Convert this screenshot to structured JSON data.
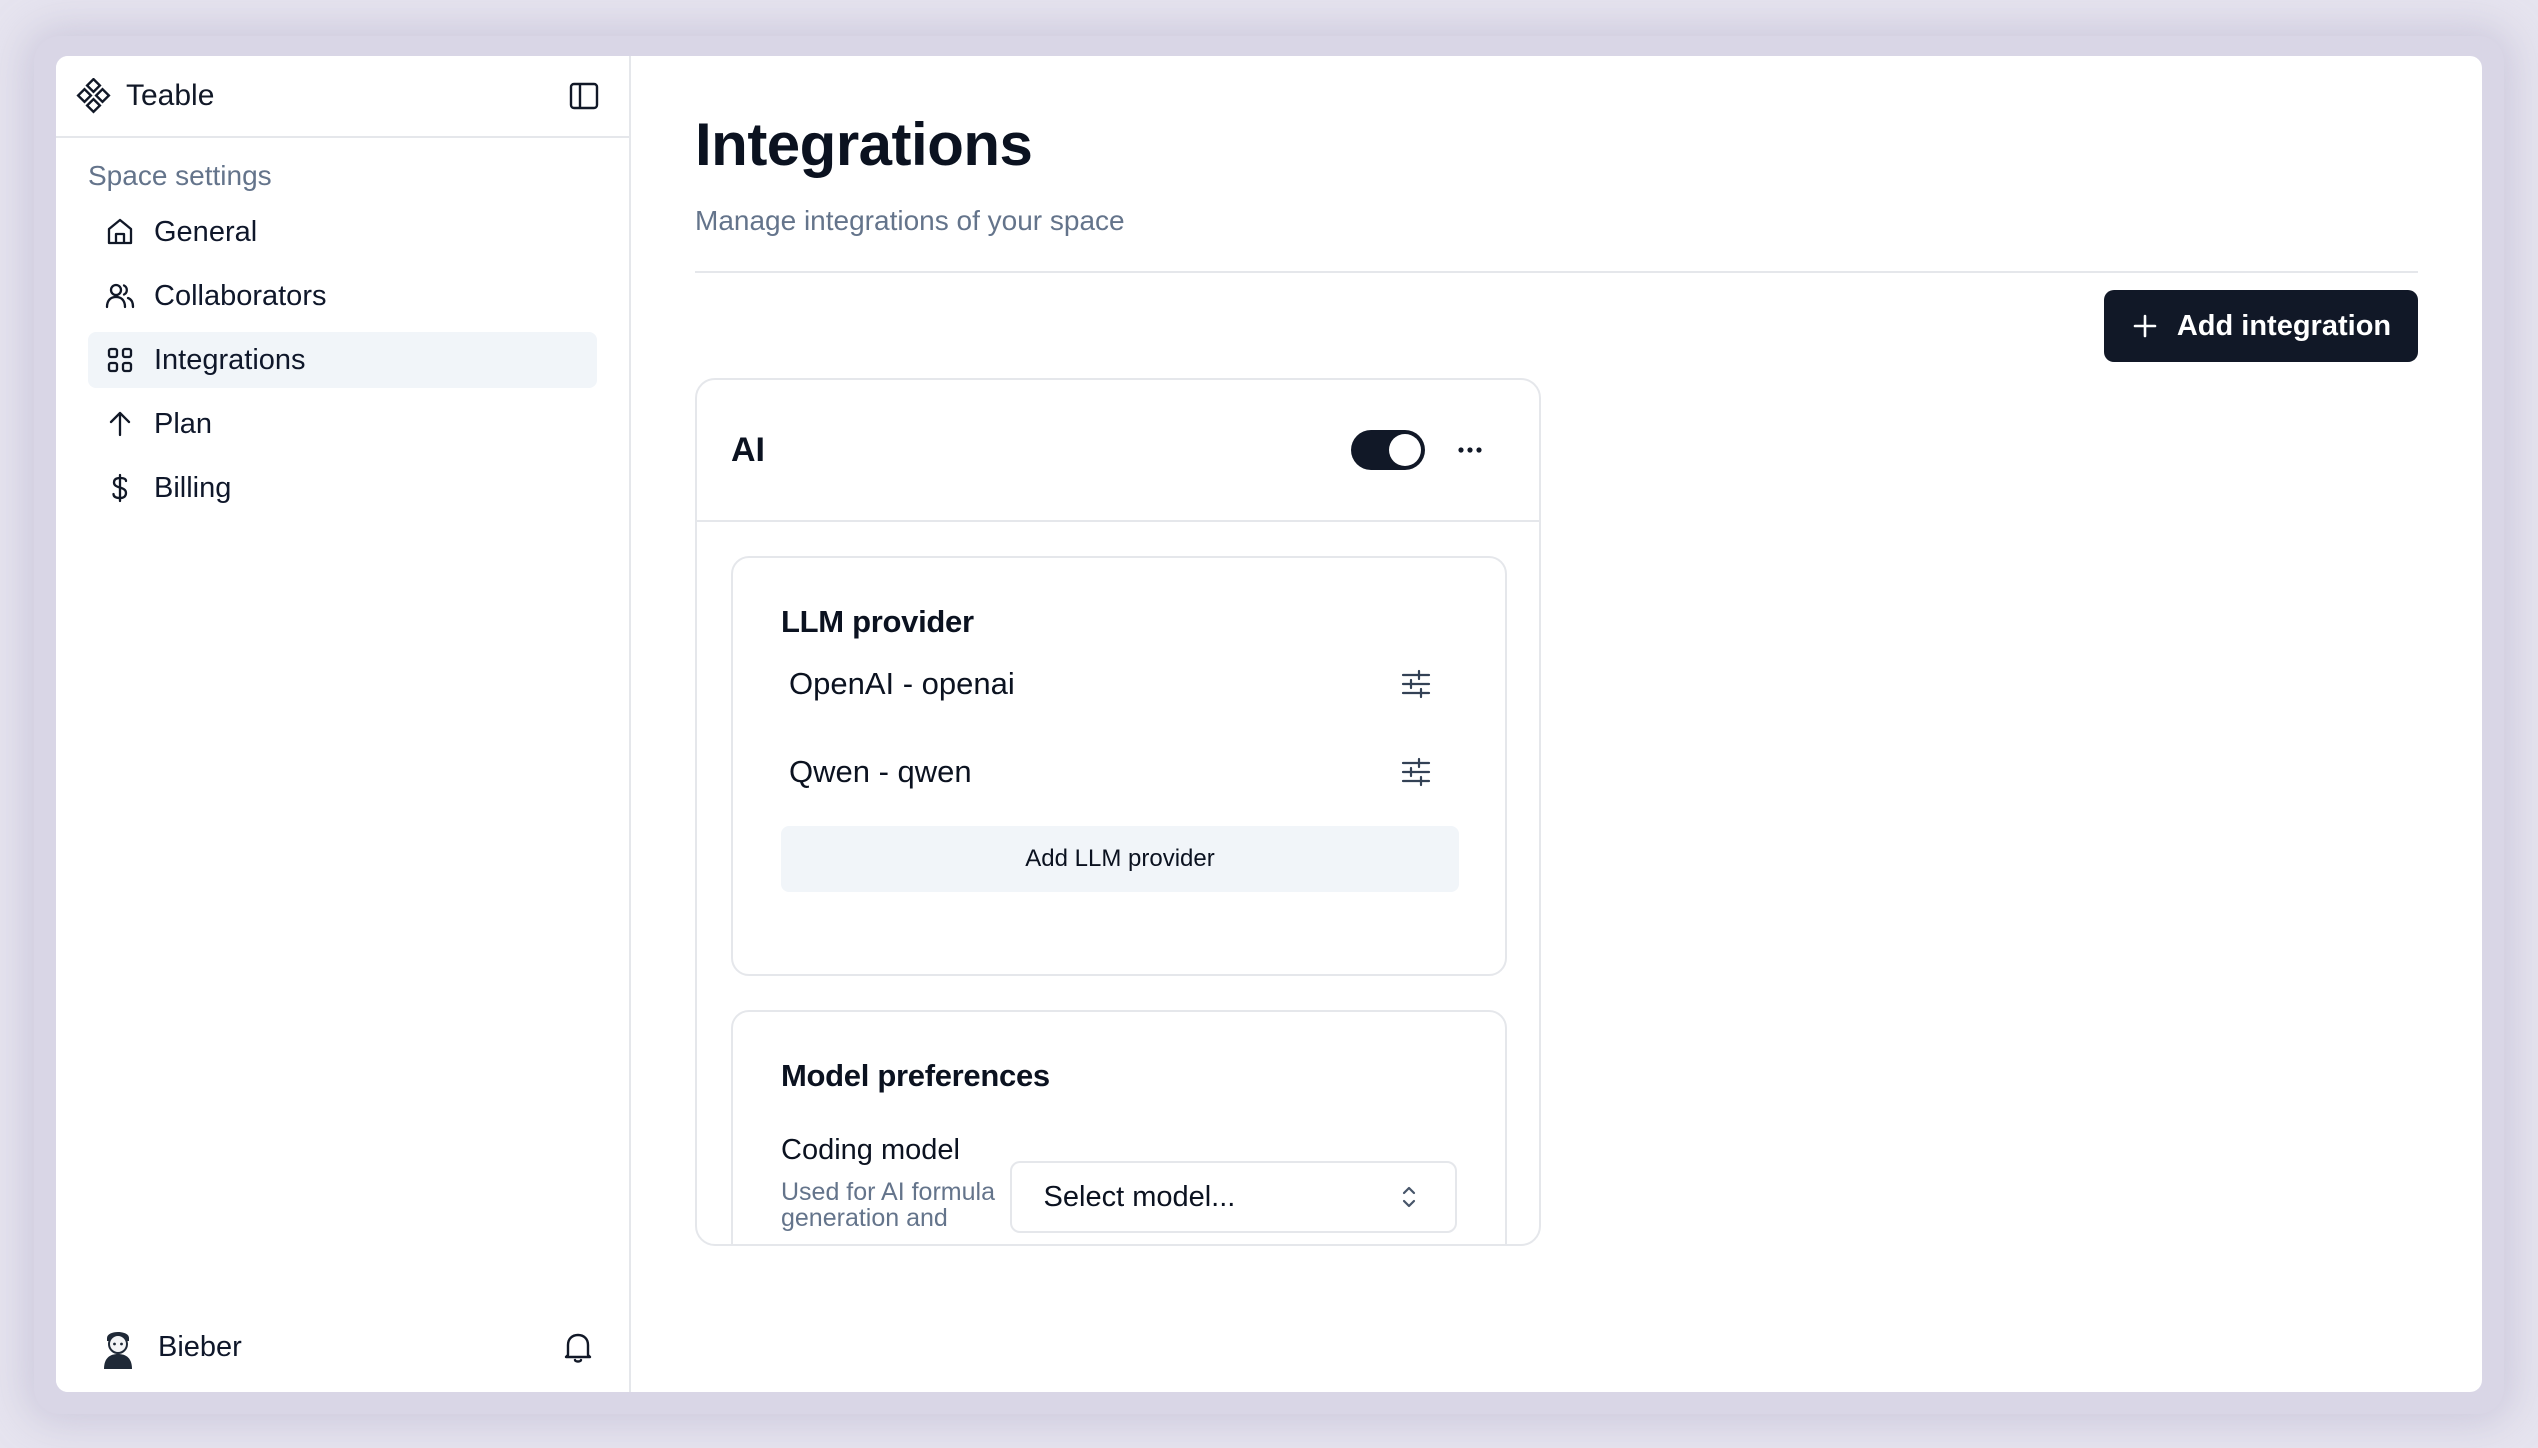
{
  "app": {
    "name": "Teable"
  },
  "sidebar": {
    "section_label": "Space settings",
    "items": [
      {
        "label": "General",
        "icon": "home-icon",
        "active": false
      },
      {
        "label": "Collaborators",
        "icon": "users-icon",
        "active": false
      },
      {
        "label": "Integrations",
        "icon": "grid-icon",
        "active": true
      },
      {
        "label": "Plan",
        "icon": "arrow-up-icon",
        "active": false
      },
      {
        "label": "Billing",
        "icon": "dollar-icon",
        "active": false
      }
    ],
    "user": {
      "name": "Bieber"
    }
  },
  "main": {
    "title": "Integrations",
    "subtitle": "Manage integrations of your space",
    "add_button_label": "Add integration"
  },
  "ai_card": {
    "title": "AI",
    "enabled": true,
    "llm_provider": {
      "title": "LLM provider",
      "providers": [
        {
          "label": "OpenAI - openai"
        },
        {
          "label": "Qwen - qwen"
        }
      ],
      "add_label": "Add LLM provider"
    },
    "model_preferences": {
      "title": "Model preferences",
      "coding_model": {
        "label": "Coding model",
        "description": "Used for AI formula generation and",
        "select_value": "Select model..."
      }
    }
  },
  "colors": {
    "primary": "#111827",
    "muted_text": "#64748b",
    "border": "#e5e7eb",
    "active_bg": "#f1f5f9"
  }
}
